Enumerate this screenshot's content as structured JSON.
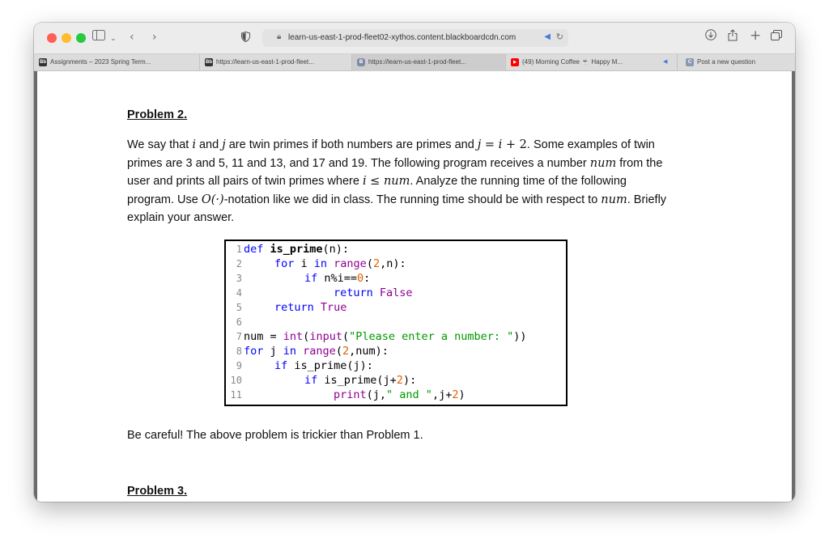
{
  "browser": {
    "url": "learn-us-east-1-prod-fleet02-xythos.content.blackboardcdn.com",
    "tabs": [
      {
        "label": "Assignments – 2023 Spring Term...",
        "favicon": "Bb",
        "color": "#333333"
      },
      {
        "label": "https://learn-us-east-1-prod-fleet...",
        "favicon": "Bb",
        "color": "#333333"
      },
      {
        "label": "https://learn-us-east-1-prod-fleet...",
        "favicon": "B",
        "color": "#7d8ba6"
      },
      {
        "label": "(49) Morning Coffee ☕ Happy M...",
        "favicon": "▶",
        "color": "#ff0000"
      },
      {
        "label": "Post a new question",
        "favicon": "C",
        "color": "#8a9bb0"
      }
    ]
  },
  "document": {
    "problem2_title": "Problem 2.",
    "paragraph": {
      "l1_a": "We say that ",
      "i": "i",
      "and": " and ",
      "j": "j",
      "l1_b": " are twin primes if both numbers are primes and ",
      "eq": " = ",
      "plus2": " + 2",
      "l1_c": ". Some examples of twin",
      "l2": "primes are 3 and 5, 11 and 13, and 17 and 19. The following program receives a number ",
      "num": "num",
      "l2_b": " from the",
      "l3_a": "user and prints all pairs of twin primes where ",
      "le": " ≤ ",
      "l3_b": ". Analyze the running time of the following",
      "l4_a": "program. Use ",
      "bigo": "O(·)",
      "l4_b": "-notation like we did in class. The running time should be with respect to ",
      "l4_c": ". Briefly",
      "l5": "explain your answer."
    },
    "footer_text": "Be careful! The above problem is trickier than Problem 1.",
    "problem3_title": "Problem 3."
  },
  "code": {
    "line_numbers": [
      "1",
      "2",
      "3",
      "4",
      "5",
      "6",
      "7",
      "8",
      "9",
      "10",
      "11"
    ],
    "t": {
      "def": "def ",
      "is_prime_def": "is_prime",
      "n_paren": "(n):",
      "for": "for ",
      "i": "i ",
      "in": "in ",
      "range": "range",
      "range_args_open": "(",
      "two": "2",
      "comma_n_close": ",n):",
      "if": "if ",
      "n_mod_i": "n%i==",
      "zero": "0",
      "colon": ":",
      "return": "return ",
      "false": "False",
      "true": "True",
      "num_assign": "num = ",
      "int": "int",
      "open": "(",
      "input": "input",
      "prompt": "\"Please enter a number: \"",
      "close2": "))",
      "j": "j ",
      "comma_num_close": ",num):",
      "is_prime_call_j": "is_prime(j):",
      "is_prime_call": "is_prime(j+",
      "close_colon": "):",
      "print": "print",
      "print_a": "(j,",
      "and_str": "\" and \"",
      "print_b": ",j+",
      "close": ")"
    }
  }
}
